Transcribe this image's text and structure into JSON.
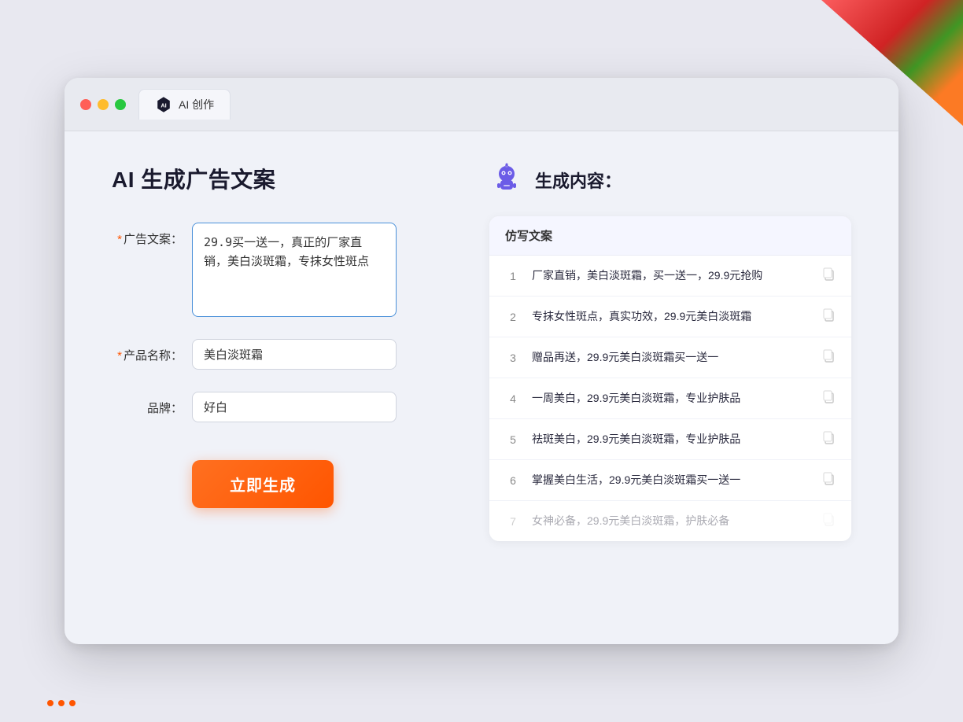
{
  "background": {
    "color": "#e8e8f0"
  },
  "browser": {
    "tab_label": "AI 创作",
    "tab_icon": "ai-icon"
  },
  "left_panel": {
    "page_title": "AI 生成广告文案",
    "form": {
      "ad_copy_label": "广告文案：",
      "ad_copy_required": "*",
      "ad_copy_value": "29.9买一送一，真正的厂家直销，美白淡斑霜，专抹女性斑点",
      "product_name_label": "产品名称：",
      "product_name_required": "*",
      "product_name_value": "美白淡斑霜",
      "brand_label": "品牌：",
      "brand_value": "好白"
    },
    "generate_button_label": "立即生成"
  },
  "right_panel": {
    "result_title": "生成内容：",
    "table_header": "仿写文案",
    "results": [
      {
        "num": "1",
        "text": "厂家直销，美白淡斑霜，买一送一，29.9元抢购",
        "faded": false
      },
      {
        "num": "2",
        "text": "专抹女性斑点，真实功效，29.9元美白淡斑霜",
        "faded": false
      },
      {
        "num": "3",
        "text": "赠品再送，29.9元美白淡斑霜买一送一",
        "faded": false
      },
      {
        "num": "4",
        "text": "一周美白，29.9元美白淡斑霜，专业护肤品",
        "faded": false
      },
      {
        "num": "5",
        "text": "祛斑美白，29.9元美白淡斑霜，专业护肤品",
        "faded": false
      },
      {
        "num": "6",
        "text": "掌握美白生活，29.9元美白淡斑霜买一送一",
        "faded": false
      },
      {
        "num": "7",
        "text": "女神必备，29.9元美白淡斑霜，护肤必备",
        "faded": true
      }
    ]
  }
}
